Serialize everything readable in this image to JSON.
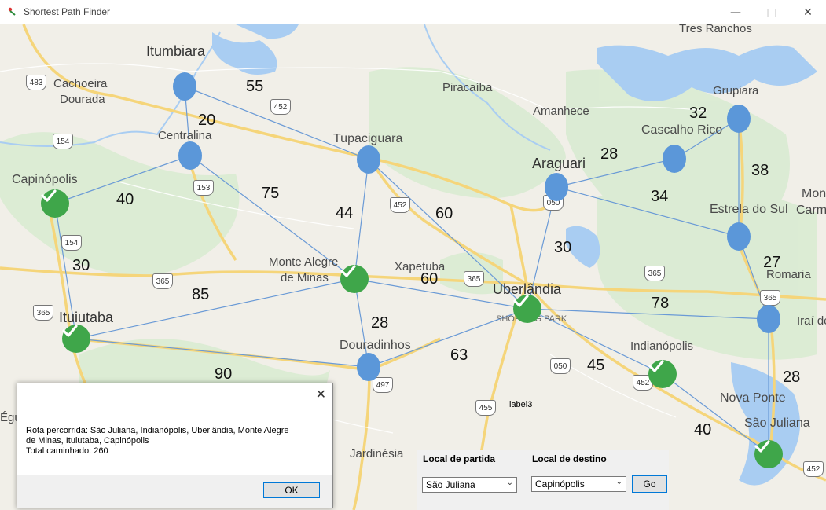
{
  "window": {
    "title": "Shortest Path Finder"
  },
  "map": {
    "places": [
      {
        "name": "Itumbiara",
        "cls": "big"
      },
      {
        "name": "Cachoeira",
        "cls": ""
      },
      {
        "name": "Dourada",
        "cls": ""
      },
      {
        "name": "Centralina",
        "cls": ""
      },
      {
        "name": "Capinópolis",
        "cls": ""
      },
      {
        "name": "Tupaciguara",
        "cls": ""
      },
      {
        "name": "Piracaíba",
        "cls": ""
      },
      {
        "name": "Amanhece",
        "cls": ""
      },
      {
        "name": "Araguari",
        "cls": "big"
      },
      {
        "name": "Tres Ranchos",
        "cls": ""
      },
      {
        "name": "Grupiara",
        "cls": ""
      },
      {
        "name": "Cascalho Rico",
        "cls": ""
      },
      {
        "name": "Estrela do Sul",
        "cls": ""
      },
      {
        "name": "Monte Alegre",
        "cls": ""
      },
      {
        "name": "de Minas",
        "cls": ""
      },
      {
        "name": "Xapetuba",
        "cls": ""
      },
      {
        "name": "Uberlândia",
        "cls": "big"
      },
      {
        "name": "SHOPPING PARK",
        "cls": "small"
      },
      {
        "name": "Ituiutaba",
        "cls": "big"
      },
      {
        "name": "Douradinhos",
        "cls": ""
      },
      {
        "name": "Indianópolis",
        "cls": ""
      },
      {
        "name": "Romaria",
        "cls": ""
      },
      {
        "name": "Iraí de",
        "cls": ""
      },
      {
        "name": "Nova Ponte",
        "cls": ""
      },
      {
        "name": "São Juliana",
        "cls": ""
      },
      {
        "name": "Jardinésia",
        "cls": ""
      },
      {
        "name": "Mon",
        "cls": ""
      },
      {
        "name": "Carm",
        "cls": ""
      },
      {
        "name": "Égu",
        "cls": ""
      }
    ],
    "shields": [
      "483",
      "154",
      "452",
      "153",
      "154",
      "365",
      "365",
      "452",
      "365",
      "050",
      "365",
      "365",
      "050",
      "497",
      "455",
      "452",
      "452"
    ],
    "weights": [
      "55",
      "20",
      "40",
      "75",
      "44",
      "60",
      "28",
      "34",
      "32",
      "38",
      "30",
      "30",
      "60",
      "85",
      "28",
      "63",
      "45",
      "78",
      "27",
      "90",
      "40",
      "28"
    ],
    "nodes": [
      {
        "city": "Itumbiara",
        "state": "unvisited"
      },
      {
        "city": "Centralina",
        "state": "unvisited"
      },
      {
        "city": "Capinópolis",
        "state": "visited"
      },
      {
        "city": "Tupaciguara",
        "state": "unvisited"
      },
      {
        "city": "Araguari",
        "state": "unvisited"
      },
      {
        "city": "Cascalho Rico",
        "state": "unvisited"
      },
      {
        "city": "Grupiara",
        "state": "unvisited"
      },
      {
        "city": "Estrela do Sul",
        "state": "unvisited"
      },
      {
        "city": "Monte Alegre de Minas",
        "state": "visited"
      },
      {
        "city": "Uberlândia",
        "state": "visited"
      },
      {
        "city": "Romaria",
        "state": "unvisited"
      },
      {
        "city": "Ituiutaba",
        "state": "visited"
      },
      {
        "city": "Douradinhos",
        "state": "unvisited"
      },
      {
        "city": "Indianópolis",
        "state": "visited"
      },
      {
        "city": "São Juliana",
        "state": "visited"
      }
    ],
    "colors": {
      "unvisited": "#5b97d9",
      "visited": "#3fa64a",
      "edge": "#6a9ad6",
      "water": "#a8cdf0",
      "green": "#d6ead0",
      "road": "#f6d878"
    }
  },
  "label3": "label3",
  "controls": {
    "origin_label": "Local de partida",
    "destination_label": "Local de destino",
    "origin_value": "São Juliana",
    "destination_value": "Capinópolis",
    "go_label": "Go"
  },
  "dialog": {
    "line1": "Rota percorrida: São Juliana, Indianópolis, Uberlândia, Monte Alegre",
    "line2": "de Minas, Ituiutaba, Capinópolis",
    "line3": "Total caminhado: 260",
    "ok_label": "OK"
  }
}
